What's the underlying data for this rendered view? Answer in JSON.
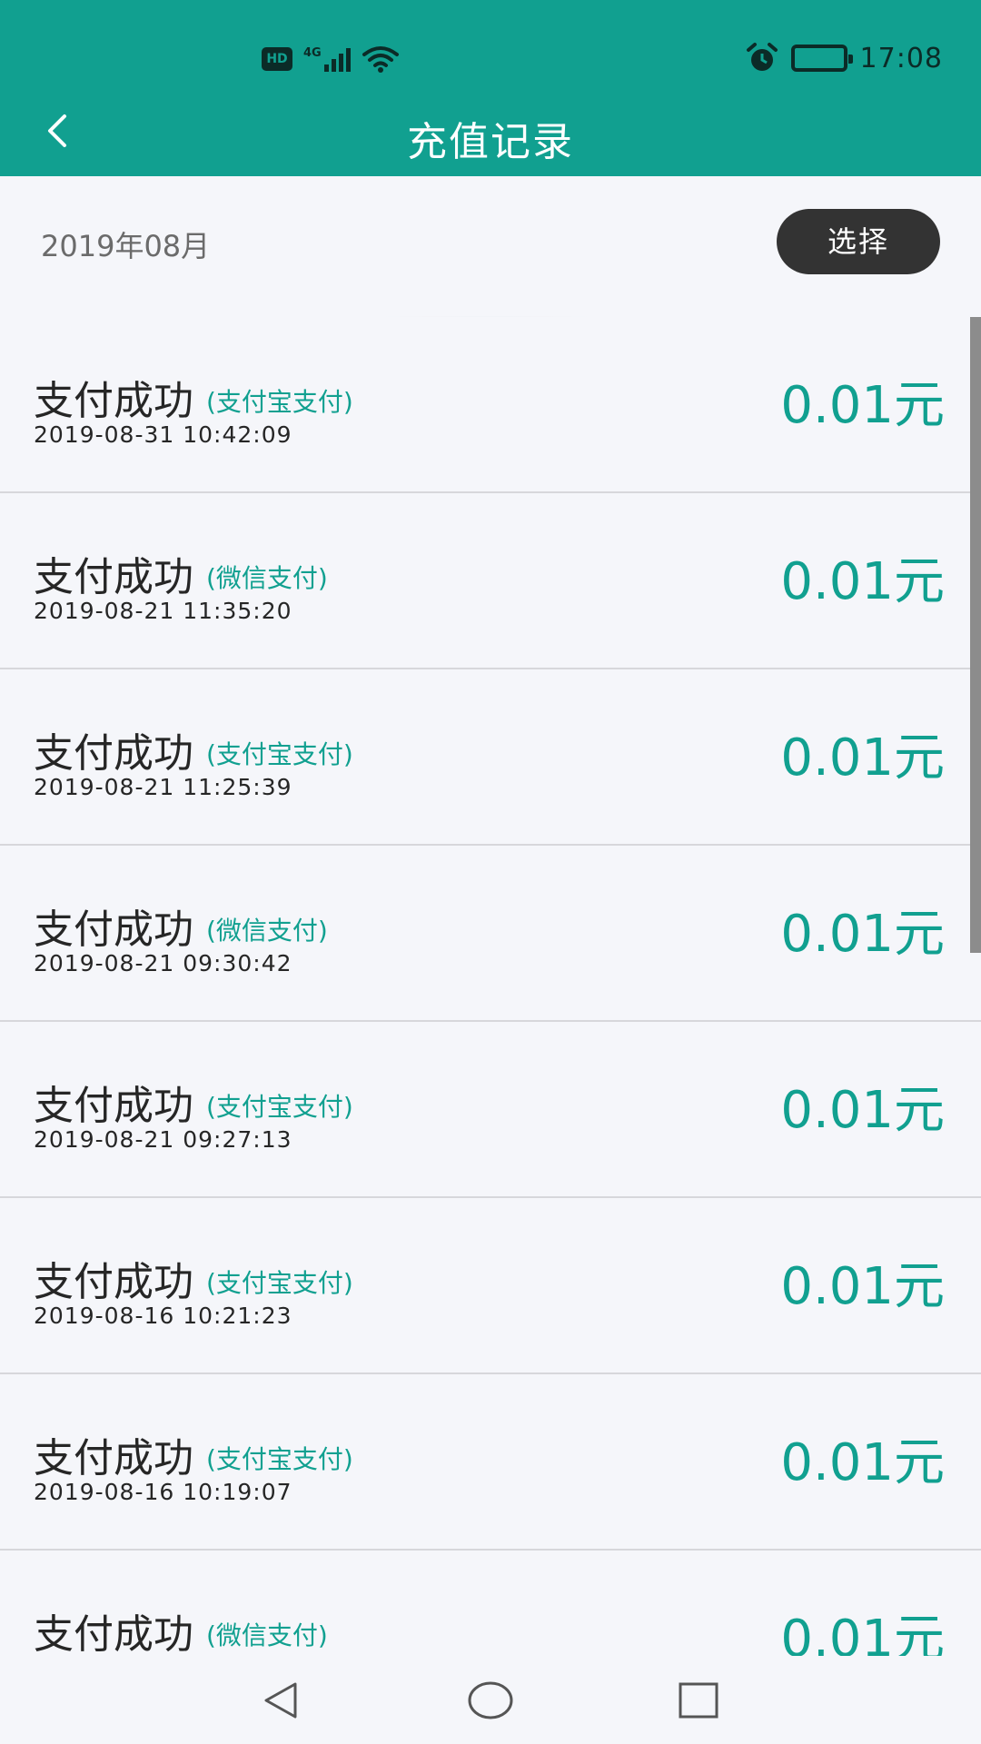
{
  "status_bar": {
    "hd_label": "HD",
    "network": "4G",
    "time": "17:08"
  },
  "header": {
    "title": "充值记录",
    "back_icon": "chevron-left-icon",
    "background_color": "#11a090"
  },
  "filter": {
    "date_label": "2019年08月",
    "select_label": "选择"
  },
  "records": [
    {
      "status": "支付成功",
      "method": "(支付宝支付)",
      "time": "2019-08-31 10:42:09",
      "amount": "0.01元"
    },
    {
      "status": "支付成功",
      "method": "(微信支付)",
      "time": "2019-08-21 11:35:20",
      "amount": "0.01元"
    },
    {
      "status": "支付成功",
      "method": "(支付宝支付)",
      "time": "2019-08-21 11:25:39",
      "amount": "0.01元"
    },
    {
      "status": "支付成功",
      "method": "(微信支付)",
      "time": "2019-08-21 09:30:42",
      "amount": "0.01元"
    },
    {
      "status": "支付成功",
      "method": "(支付宝支付)",
      "time": "2019-08-21 09:27:13",
      "amount": "0.01元"
    },
    {
      "status": "支付成功",
      "method": "(支付宝支付)",
      "time": "2019-08-16 10:21:23",
      "amount": "0.01元"
    },
    {
      "status": "支付成功",
      "method": "(支付宝支付)",
      "time": "2019-08-16 10:19:07",
      "amount": "0.01元"
    },
    {
      "status": "支付成功",
      "method": "(微信支付)",
      "time": "",
      "amount": "0.01元"
    }
  ],
  "colors": {
    "accent": "#11a090",
    "text_dark": "#262626",
    "text_muted": "#6b6b6b",
    "button_dark": "#333333",
    "background": "#f5f6fa"
  },
  "system_nav": {
    "back_icon": "triangle-back-icon",
    "home_icon": "circle-home-icon",
    "recents_icon": "square-recents-icon"
  }
}
